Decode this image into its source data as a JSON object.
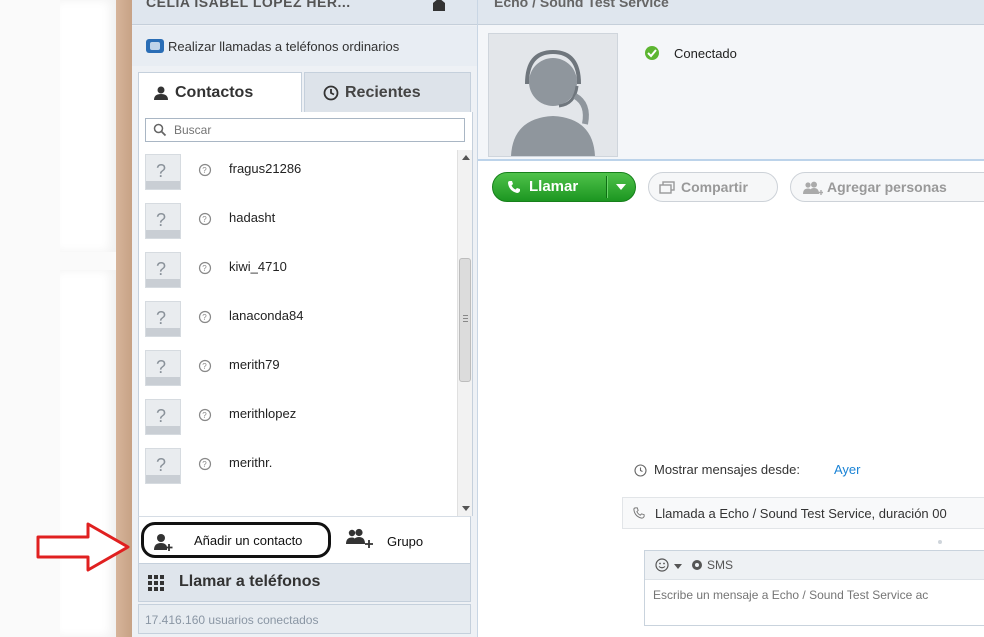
{
  "left_panel": {
    "user_name": "CELIA ISABEL LOPEZ HER...",
    "phone_calls_link": "Realizar llamadas a teléfonos ordinarios",
    "tabs": [
      {
        "label": "Contactos"
      },
      {
        "label": "Recientes"
      }
    ],
    "search": {
      "placeholder": "Buscar"
    },
    "contacts": [
      {
        "name": "fragus21286"
      },
      {
        "name": "hadasht"
      },
      {
        "name": "kiwi_4710"
      },
      {
        "name": "lanaconda84"
      },
      {
        "name": "merith79"
      },
      {
        "name": "merithlopez"
      },
      {
        "name": "merithr."
      }
    ],
    "actions": {
      "add_contact": "Añadir un contacto",
      "group": "Grupo"
    },
    "call_phones": "Llamar a teléfonos",
    "users_online": "17.416.160 usuarios conectados"
  },
  "right_panel": {
    "title": "Echo / Sound Test Service",
    "status": "Conectado",
    "toolbar": {
      "call": "Llamar",
      "share": "Compartir",
      "add_people": "Agregar personas"
    },
    "show_messages_label": "Mostrar mensajes desde:",
    "show_messages_value": "Ayer",
    "call_event": "Llamada a Echo / Sound Test Service, duración 00",
    "composer": {
      "sms_label": "SMS",
      "placeholder": "Escribe un mensaje a Echo / Sound Test Service ac"
    }
  },
  "colors": {
    "call_green": "#1c9621",
    "link_blue": "#1a83d6",
    "arrow_red": "#e02020"
  }
}
